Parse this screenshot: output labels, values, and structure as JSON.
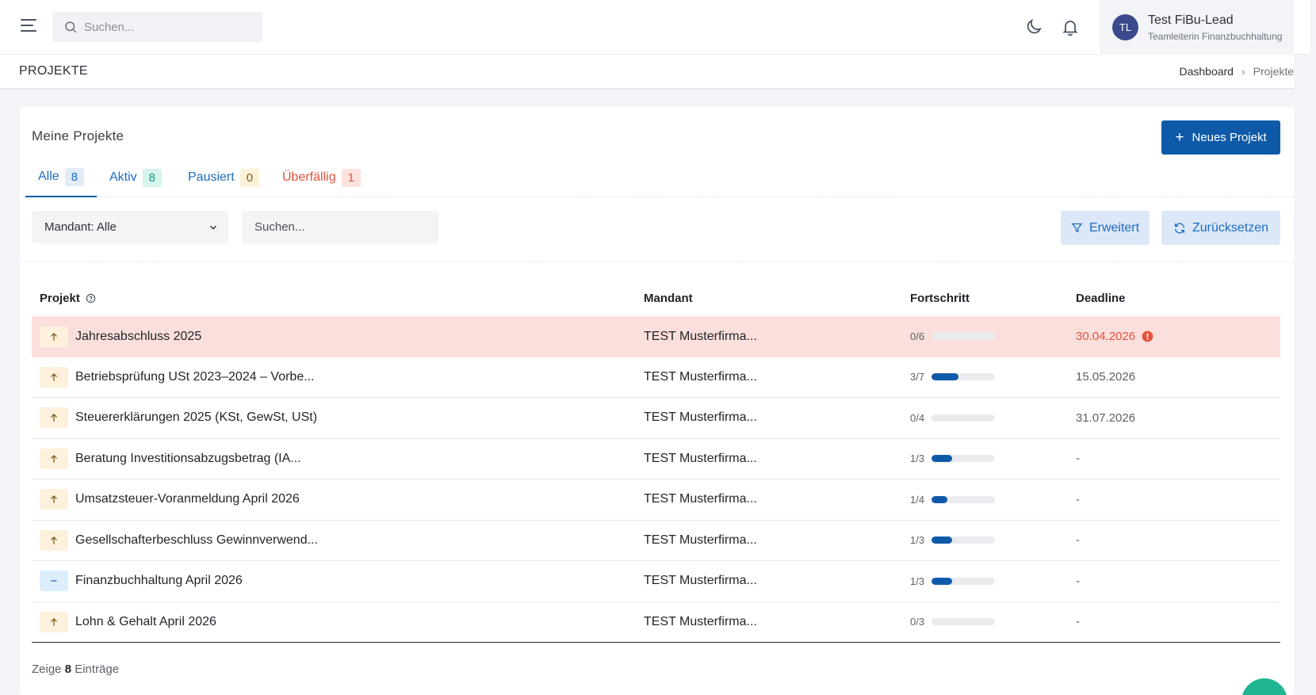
{
  "topbar": {
    "search_placeholder": "Suchen...",
    "user": {
      "initials": "TL",
      "name": "Test FiBu-Lead",
      "role": "Teamleiterin Finanzbuchhaltung"
    }
  },
  "page": {
    "title": "PROJEKTE",
    "breadcrumb": {
      "home": "Dashboard",
      "separator": "›",
      "current": "Projekte"
    }
  },
  "card": {
    "title": "Meine Projekte",
    "new_button": {
      "icon": "+",
      "label": "Neues Projekt"
    },
    "tabs": [
      {
        "label": "Alle",
        "count": "8",
        "color": "#1e6bbf",
        "badge_bg": "#e1ecf8",
        "badge_color": "#1e6bbf"
      },
      {
        "label": "Aktiv",
        "count": "8",
        "color": "#1e6bbf",
        "badge_bg": "#d6f3ec",
        "badge_color": "#169b7c"
      },
      {
        "label": "Pausiert",
        "count": "0",
        "color": "#1e6bbf",
        "badge_bg": "#fcf1d9",
        "badge_color": "#7a5c12"
      },
      {
        "label": "Überfällig",
        "count": "1",
        "color": "#e4533d",
        "badge_bg": "#fde2de",
        "badge_color": "#e4533d"
      }
    ],
    "filters": {
      "mandant_select": "Mandant: Alle",
      "search_placeholder": "Suchen...",
      "advanced_button": "Erweitert",
      "reset_button": "Zurücksetzen"
    },
    "table": {
      "headers": {
        "project": "Projekt",
        "mandant": "Mandant",
        "progress": "Fortschritt",
        "deadline": "Deadline"
      },
      "rows": [
        {
          "priority": "up",
          "name": "Jahresabschluss 2025",
          "mandant": "TEST Musterfirma...",
          "progress_text": "0/6",
          "progress": 0.0,
          "deadline": "30.04.2026",
          "overdue": true
        },
        {
          "priority": "up",
          "name": "Betriebsprüfung USt 2023–2024 – Vorbe...",
          "mandant": "TEST Musterfirma...",
          "progress_text": "3/7",
          "progress": 0.43,
          "deadline": "15.05.2026",
          "overdue": false
        },
        {
          "priority": "up",
          "name": "Steuererklärungen 2025 (KSt, GewSt, USt)",
          "mandant": "TEST Musterfirma...",
          "progress_text": "0/4",
          "progress": 0.0,
          "deadline": "31.07.2026",
          "overdue": false
        },
        {
          "priority": "up",
          "name": "Beratung Investitionsabzugsbetrag (IA...",
          "mandant": "TEST Musterfirma...",
          "progress_text": "1/3",
          "progress": 0.33,
          "deadline": "-",
          "overdue": false
        },
        {
          "priority": "up",
          "name": "Umsatzsteuer-Voranmeldung April 2026",
          "mandant": "TEST Musterfirma...",
          "progress_text": "1/4",
          "progress": 0.25,
          "deadline": "-",
          "overdue": false
        },
        {
          "priority": "up",
          "name": "Gesellschafterbeschluss Gewinnverwend...",
          "mandant": "TEST Musterfirma...",
          "progress_text": "1/3",
          "progress": 0.33,
          "deadline": "-",
          "overdue": false
        },
        {
          "priority": "dash",
          "name": "Finanzbuchhaltung April 2026",
          "mandant": "TEST Musterfirma...",
          "progress_text": "1/3",
          "progress": 0.33,
          "deadline": "-",
          "overdue": false
        },
        {
          "priority": "up",
          "name": "Lohn & Gehalt April 2026",
          "mandant": "TEST Musterfirma...",
          "progress_text": "0/3",
          "progress": 0.0,
          "deadline": "-",
          "overdue": false
        }
      ]
    },
    "footer": {
      "prefix": "Zeige",
      "count": "8",
      "suffix": "Einträge"
    }
  },
  "colors": {
    "primary": "#0f5aa8",
    "overdue_row": "#fbdfdc",
    "overdue_text": "#e4533d",
    "fab": "#1fb591"
  },
  "icons": {
    "menu": "hamburger-icon",
    "search": "search-icon",
    "theme": "moon-icon",
    "notifications": "bell-icon",
    "filter": "filter-icon",
    "reset": "refresh-icon",
    "help": "help-circle-icon",
    "warning": "alert-circle-icon",
    "priority_up": "arrow-up-icon",
    "priority_normal": "minus-icon"
  }
}
